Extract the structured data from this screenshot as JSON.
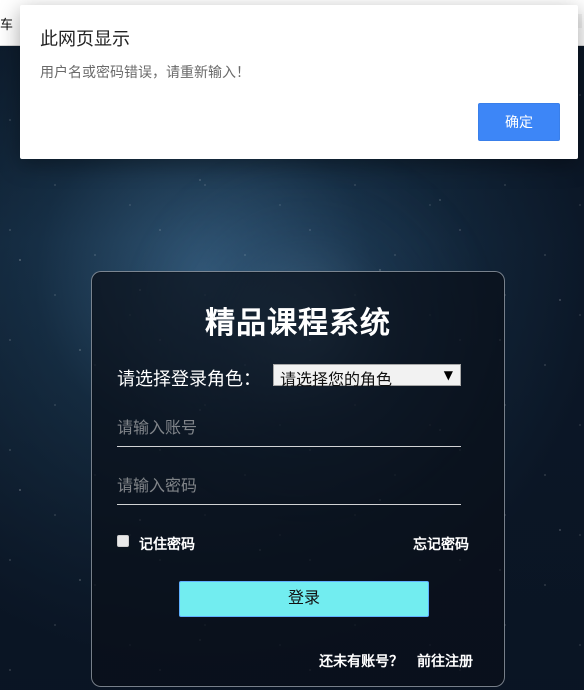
{
  "browser": {
    "left_text": "车"
  },
  "dialog": {
    "title": "此网页显示",
    "message": "用户名或密码错误，请重新输入！",
    "ok_label": "确定"
  },
  "login": {
    "title": "精品课程系统",
    "role_label": "请选择登录角色：",
    "role_selected": "请选择您的角色",
    "username_placeholder": "请输入账号",
    "password_placeholder": "请输入密码",
    "remember_label": "记住密码",
    "forgot_label": "忘记密码",
    "button_label": "登录",
    "register_prompt": "还未有账号？",
    "register_link": "前往注册"
  },
  "icons": {
    "dropdown_arrow": "▼"
  }
}
